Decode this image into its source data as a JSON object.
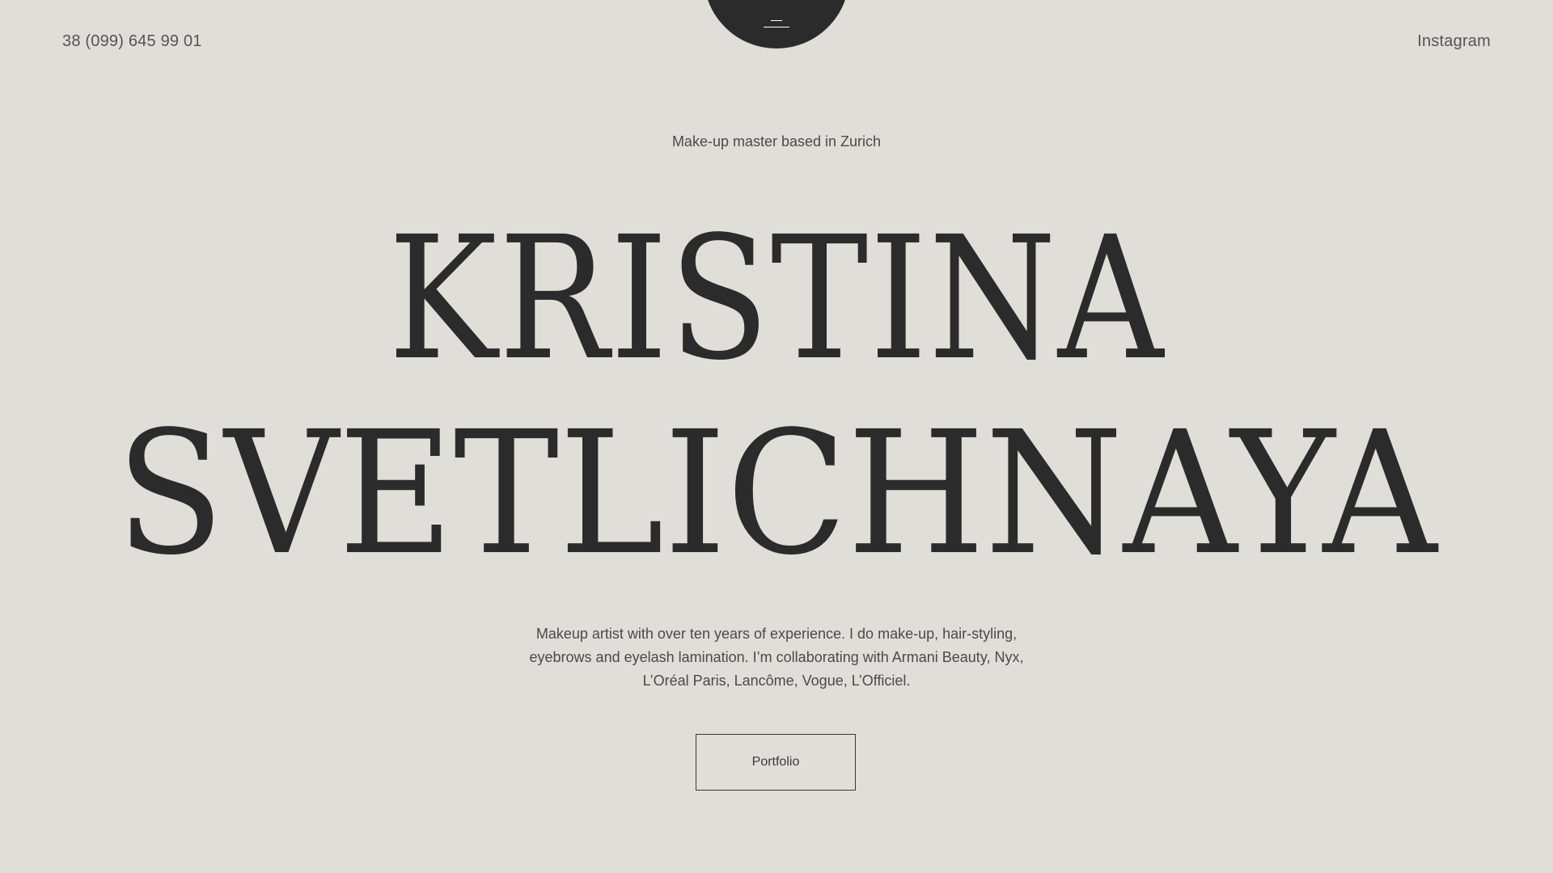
{
  "header": {
    "phone": "38 (099) 645 99 01",
    "instagram_label": "Instagram",
    "menu_icon": "hamburger-menu-icon"
  },
  "hero": {
    "tagline": "Make-up master based in Zurich",
    "name_line_1": "KRISTINA",
    "name_line_2": "SVETLICHNAYA",
    "description": "Makeup artist with over ten years of experience. I do make-up, hair-styling, eyebrows and eyelash lamination. I’m collaborating with Armani Beauty, Nyx, L’Oréal Paris, Lancôme, Vogue, L’Officiel.",
    "portfolio_label": "Portfolio"
  },
  "colors": {
    "background": "#e0ded8",
    "text": "#2b2b2b",
    "menu_circle": "#2b2b2b"
  }
}
